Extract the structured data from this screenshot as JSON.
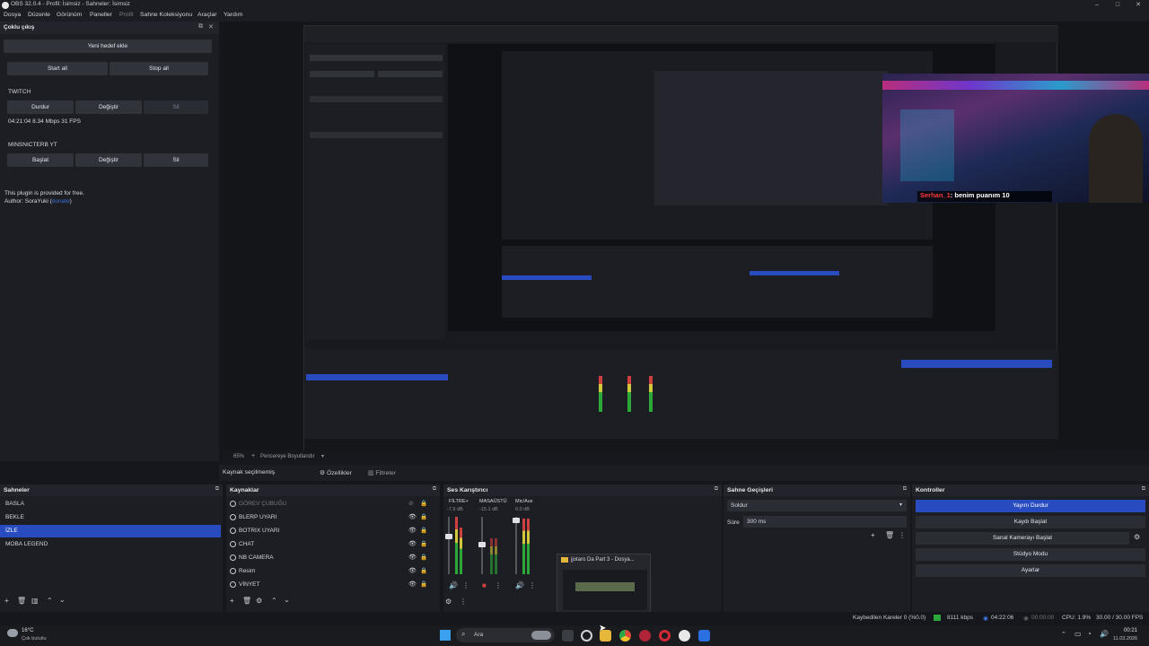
{
  "window": {
    "title": "OBS 32.0.4 - Profil: İsimsiz - Sahneler: İsimsiz"
  },
  "menu": [
    "Dosya",
    "Düzenle",
    "Görünüm",
    "Paneller",
    "Profil",
    "Sahne Koleksiyonu",
    "Araçlar",
    "Yardım"
  ],
  "multi_output": {
    "title": "Çoklu çıkış",
    "add_target": "Yeni hedef ekle",
    "start_all": "Start all",
    "stop_all": "Stop all",
    "targets": [
      {
        "name": "TWITCH",
        "btn1": "Durdur",
        "btn2": "Değiştir",
        "btn3": "Sil",
        "stats": "04:21:04  8.34 Mbps  31 FPS"
      },
      {
        "name": "MINSNICTERB YT",
        "btn1": "Başlat",
        "btn2": "Değiştir",
        "btn3": "Sil"
      }
    ],
    "note1": "This plugin is provided for free.",
    "note2_prefix": "Author: SoraYuki (",
    "note2_link": "donate",
    "note2_suffix": ")"
  },
  "preview": {
    "zoom": "65%",
    "fit_label": "Pencereye Boyutlandır",
    "chat_user": "Serhan_1",
    "chat_msg": ": benim puanım 10"
  },
  "context_bar": {
    "no_source": "Kaynak seçilmemiş",
    "properties": "Özellikler",
    "filters": "Filtreler"
  },
  "scenes": {
    "title": "Sahneler",
    "items": [
      "BASLA",
      "BEKLE",
      "İZLE",
      "MOBA LEGEND"
    ],
    "selected": 2
  },
  "sources": {
    "title": "Kaynaklar",
    "items": [
      "GÖREV ÇUBUĞU",
      "BLERP UYARI",
      "BOTRIX UYARI",
      "CHAT",
      "NB CAMERA",
      "Resim",
      "VİNYET"
    ]
  },
  "mixer": {
    "title": "Ses Karıştırıcı",
    "channels": [
      {
        "name": "FİLTRE+",
        "db": "-7.9 dB"
      },
      {
        "name": "MASAÜSTÜ",
        "db": "-15.1 dB"
      },
      {
        "name": "Mic/Aux",
        "db": "0.0 dB"
      }
    ]
  },
  "explorer_popup": {
    "title": "jjotaro Da Part 3 - Dosya..."
  },
  "transitions": {
    "title": "Sahne Geçişleri",
    "type": "Soldur",
    "duration_label": "Süre",
    "duration": "300 ms"
  },
  "controls": {
    "title": "Kontroller",
    "buttons": [
      "Yayını Durdur",
      "Kaydı Başlat",
      "Sanal Kamerayı Başlat",
      "Stüdyo Modu",
      "Ayarlar"
    ]
  },
  "status": {
    "dropped": "Kaybedilen Kareler 0 (%0.0)",
    "bitrate": "8111 kbps",
    "stream_time": "04:22:06",
    "rec_time": "00:00:00",
    "cpu": "CPU: 1.9%",
    "fps": "30.00 / 30.00 FPS"
  },
  "taskbar": {
    "weather_temp": "16°C",
    "weather_desc": "Çok bulutlu",
    "search": "Ara",
    "time": "00:21",
    "date": "11.03.2026"
  }
}
